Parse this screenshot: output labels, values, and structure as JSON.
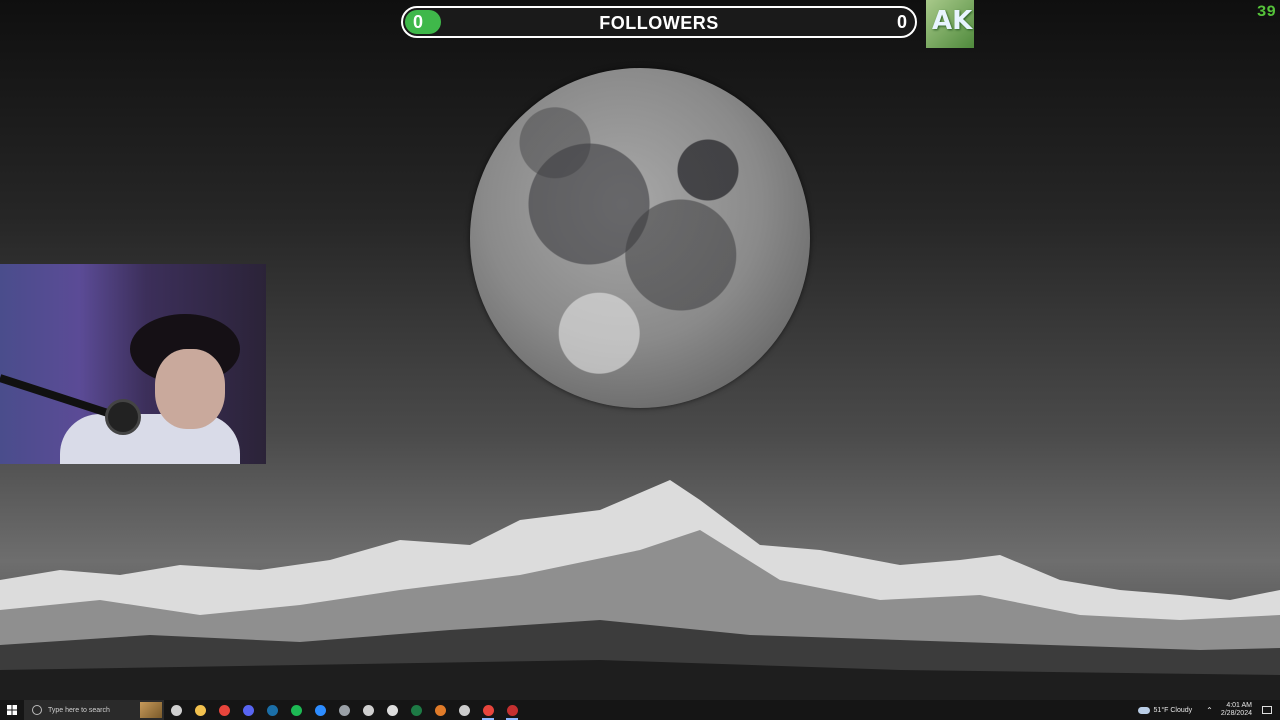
{
  "overlay": {
    "follower_label": "FOLLOWERS",
    "follower_count": "0",
    "follower_goal": "0",
    "follower_progress": 0,
    "logo_text": "AK",
    "fps_counter": "39",
    "accent": "#3fb84a"
  },
  "taskbar": {
    "search_placeholder": "Type here to search",
    "apps": [
      {
        "name": "task-view-icon",
        "color": "#cfcfcf"
      },
      {
        "name": "file-explorer-icon",
        "color": "#f2c14e"
      },
      {
        "name": "chrome-icon",
        "color": "#e8453c"
      },
      {
        "name": "discord-icon",
        "color": "#5865f2"
      },
      {
        "name": "steam-icon",
        "color": "#1b6fa8"
      },
      {
        "name": "spotify-icon",
        "color": "#1db954"
      },
      {
        "name": "zoom-icon",
        "color": "#2d8cff"
      },
      {
        "name": "app-icon",
        "color": "#9aa0a6"
      },
      {
        "name": "back-app-icon",
        "color": "#cfcfcf"
      },
      {
        "name": "epic-games-icon",
        "color": "#dddddd"
      },
      {
        "name": "excel-icon",
        "color": "#1d7a45"
      },
      {
        "name": "game-icon",
        "color": "#e07b29"
      },
      {
        "name": "unity-icon",
        "color": "#cccccc"
      },
      {
        "name": "chrome-icon",
        "color": "#e8453c"
      },
      {
        "name": "obs-icon",
        "color": "#c53030"
      }
    ],
    "weather": "51°F  Cloudy",
    "time": "4:01 AM",
    "date": "2/28/2024"
  }
}
